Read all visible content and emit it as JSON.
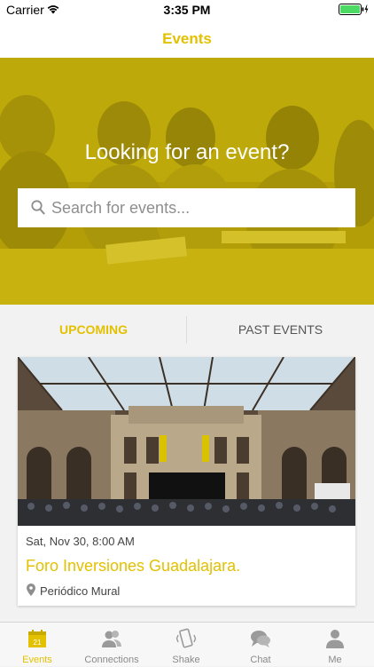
{
  "status_bar": {
    "carrier": "Carrier",
    "time": "3:35 PM"
  },
  "nav": {
    "title": "Events"
  },
  "hero": {
    "headline": "Looking for an event?"
  },
  "search": {
    "placeholder": "Search for events..."
  },
  "tabs": [
    {
      "label": "UPCOMING",
      "selected": true
    },
    {
      "label": "PAST EVENTS",
      "selected": false
    }
  ],
  "event": {
    "date": "Sat, Nov 30, 8:00 AM",
    "title": "Foro Inversiones Guadalajara.",
    "venue": "Periódico Mural"
  },
  "tab_bar": {
    "items": [
      {
        "label": "Events",
        "icon": "calendar-icon",
        "active": true,
        "icon_text": "21"
      },
      {
        "label": "Connections",
        "icon": "people-icon",
        "active": false
      },
      {
        "label": "Shake",
        "icon": "phone-shake-icon",
        "active": false
      },
      {
        "label": "Chat",
        "icon": "chat-bubbles-icon",
        "active": false
      },
      {
        "label": "Me",
        "icon": "person-icon",
        "active": false
      }
    ]
  },
  "colors": {
    "accent": "#e3c100",
    "hero_tint": "#d4ba00",
    "tab_inactive": "#8a8a8a",
    "battery": "#4cd964"
  }
}
